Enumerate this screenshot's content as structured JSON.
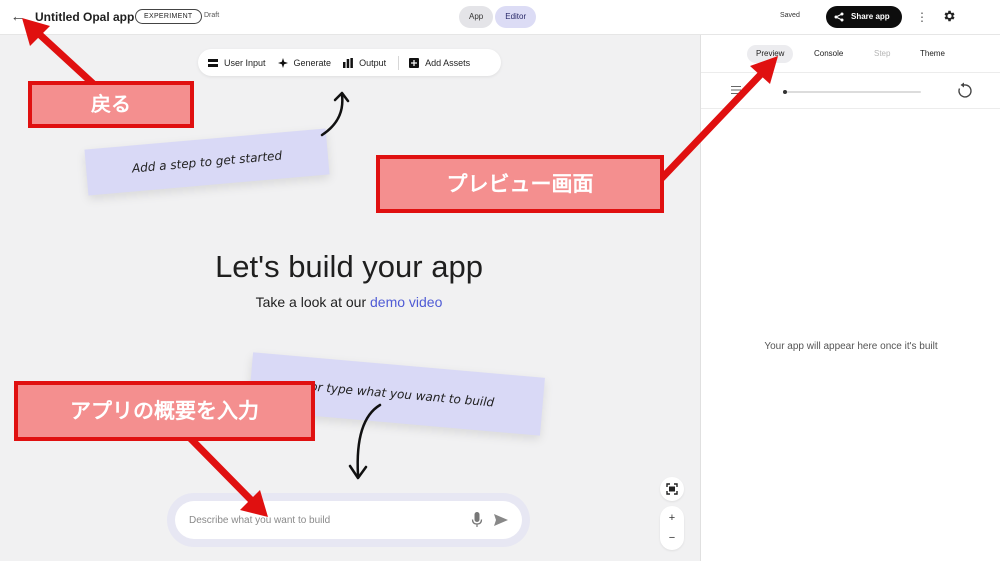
{
  "header": {
    "back_icon": "arrow-left-icon",
    "title": "Untitled Opal app",
    "badge": "EXPERIMENT",
    "draft": "Draft",
    "modes": [
      {
        "label": "App",
        "active": false
      },
      {
        "label": "Editor",
        "active": true
      }
    ],
    "saved": "Saved",
    "share_label": "Share app",
    "share_icon": "share-icon",
    "more_icon": "more-vert-icon",
    "settings_icon": "gear-icon"
  },
  "toolbar": {
    "items": [
      {
        "label": "User Input",
        "icon": "user-input-icon"
      },
      {
        "label": "Generate",
        "icon": "sparkle-icon"
      },
      {
        "label": "Output",
        "icon": "output-icon"
      },
      {
        "label": "Add Assets",
        "icon": "add-box-icon"
      }
    ]
  },
  "canvas": {
    "hint_step": "Add a step to get started",
    "hint_type": "...or type what you want to build",
    "headline": "Let's build your app",
    "sub_prefix": "Take a look at our",
    "sub_link": "demo video",
    "prompt_placeholder": "Describe what you want to build",
    "zoom": {
      "fit_icon": "fit-screen-icon",
      "in": "+",
      "out": "−"
    }
  },
  "panel": {
    "tabs": [
      {
        "label": "Preview",
        "active": true,
        "disabled": false
      },
      {
        "label": "Console",
        "active": false,
        "disabled": false
      },
      {
        "label": "Step",
        "active": false,
        "disabled": true
      },
      {
        "label": "Theme",
        "active": false,
        "disabled": false
      }
    ],
    "progress": 0,
    "empty_message": "Your app will appear here once it's built"
  },
  "annotations": {
    "back": "戻る",
    "preview": "プレビュー画面",
    "input": "アプリの概要を入力"
  },
  "colors": {
    "accent": "#4f5bd5",
    "sticky": "#d9d9f6",
    "annotation_fill": "#f48f8f",
    "annotation_border": "#e01010"
  }
}
